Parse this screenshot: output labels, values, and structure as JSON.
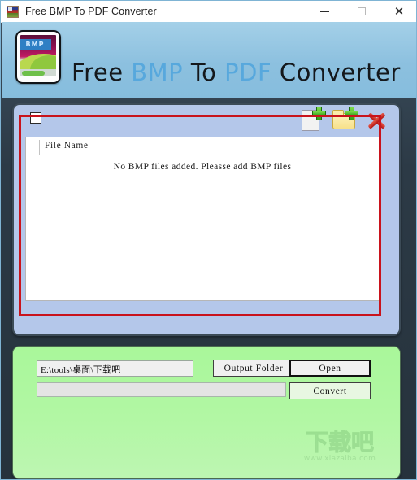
{
  "window": {
    "title": "Free BMP To PDF Converter",
    "icon": "app-icon",
    "controls": {
      "minimize": "minimize-icon",
      "maximize": "maximize-icon",
      "close": "close-icon"
    }
  },
  "header": {
    "logo_badge": "BMP",
    "brand": {
      "word1": "Free ",
      "word2": "BMP",
      "word3": " To ",
      "word4": "PDF",
      "word5": " Converter"
    }
  },
  "file_panel": {
    "select_all_checked": false,
    "toolbar": [
      {
        "name": "add-files-icon",
        "tooltip": "Add Files"
      },
      {
        "name": "add-folder-icon",
        "tooltip": "Add Folder"
      },
      {
        "name": "remove-icon",
        "tooltip": "Remove"
      }
    ],
    "columns": [
      "File Name"
    ],
    "rows": [],
    "empty_message": "No BMP files added. Pleasse add BMP files"
  },
  "output_panel": {
    "output_path": "E:\\tools\\桌面\\下载吧",
    "output_path_placeholder": "Output folder",
    "progress_percent": 0,
    "buttons": {
      "output_folder": "Output Folder",
      "open": "Open",
      "convert": "Convert"
    }
  },
  "watermark": {
    "text": "下载吧",
    "url": "www.xiazaiba.com"
  },
  "colors": {
    "accent_blue": "#57a8dd",
    "header_blue": "#8cc0df",
    "panel_blue": "#b4c7ea",
    "panel_green": "#b2f7a4",
    "annotation_red": "#c9131c",
    "background_dark": "#2c3a46"
  }
}
